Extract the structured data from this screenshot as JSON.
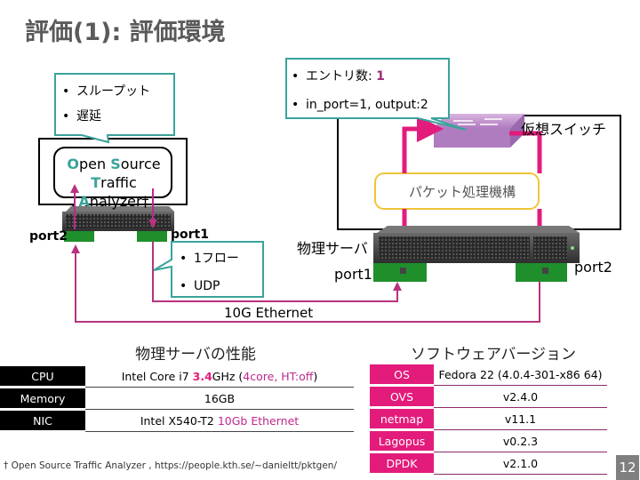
{
  "slide": {
    "title": "評価(1): 評価環境",
    "page_number": "12"
  },
  "diagram": {
    "callout_measure": {
      "items": [
        "スループット",
        "遅延"
      ]
    },
    "callout_flow_entry": {
      "item1_label": "エントリ数: ",
      "item1_value": "1",
      "item2": "in_port=1, output:2"
    },
    "callout_traffic": {
      "items": [
        "1フロー",
        "UDP"
      ]
    },
    "ostа_label": {
      "o": "O",
      "pen": "pen ",
      "s": "S",
      "ource": "ource",
      "t": "T",
      "raffic": "raffic ",
      "a": "A",
      "nalyzer": "nalyzer†"
    },
    "virtual_switch_label": "仮想スイッチ",
    "packet_processing_label": "パケット処理機構",
    "physical_server_label": "物理サーバ",
    "tester_port1": "port1",
    "tester_port2": "port2",
    "server_port1": "port1",
    "server_port2": "port2",
    "link_label": "10G Ethernet",
    "bullet": "•"
  },
  "hardware": {
    "title": "物理サーバの性能",
    "rows": [
      {
        "key": "CPU",
        "pre": "Intel Core i7 ",
        "hl1": "3.4",
        "mid": "GHz (",
        "hl2": "4core, HT:off",
        "post": ")"
      },
      {
        "key": "Memory",
        "value": "16GB"
      },
      {
        "key": "NIC",
        "pre": "Intel X540-T2 ",
        "hl": "10Gb Ethernet"
      }
    ]
  },
  "software": {
    "title": "ソフトウェアバージョン",
    "rows": [
      {
        "key": "OS",
        "value": "Fedora 22 (4.0.4-301-x86 64)"
      },
      {
        "key": "OVS",
        "value": "v2.4.0"
      },
      {
        "key": "netmap",
        "value": "v11.1"
      },
      {
        "key": "Lagopus",
        "value": "v0.2.3"
      },
      {
        "key": "DPDK",
        "value": "v2.1.0"
      }
    ]
  },
  "footnote": "† Open Source Traffic Analyzer , https://people.kth.se/~danieltt/pktgen/",
  "colors": {
    "magenta": "#e31b7b",
    "link_purple": "#b8327e",
    "teal": "#3aa39b",
    "yellow": "#f0c43a",
    "switch_purple": "#b07cc0"
  }
}
